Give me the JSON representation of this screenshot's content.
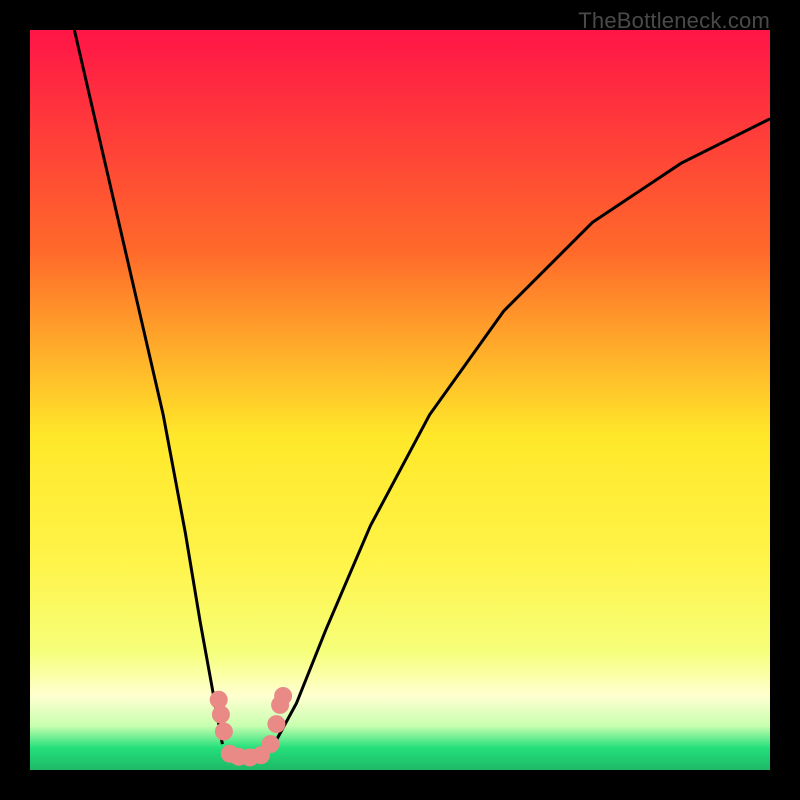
{
  "watermark": "TheBottleneck.com",
  "chart_data": {
    "type": "line",
    "title": "",
    "xlabel": "",
    "ylabel": "",
    "xlim": [
      0,
      1
    ],
    "ylim": [
      0,
      1
    ],
    "gradient_colors": {
      "top": "#ff1547",
      "upper_mid": "#ff8a2a",
      "mid": "#ffe82a",
      "lower_mid": "#f6ff7a",
      "pale": "#ffffd0",
      "bottom_green": "#25e07a",
      "bottom_green_dark": "#1db867"
    },
    "series": [
      {
        "name": "left-branch",
        "x": [
          0.06,
          0.09,
          0.12,
          0.15,
          0.18,
          0.21,
          0.23,
          0.25,
          0.26
        ],
        "y": [
          1.0,
          0.87,
          0.74,
          0.61,
          0.48,
          0.32,
          0.2,
          0.09,
          0.035
        ]
      },
      {
        "name": "right-branch",
        "x": [
          0.33,
          0.36,
          0.4,
          0.46,
          0.54,
          0.64,
          0.76,
          0.88,
          1.0
        ],
        "y": [
          0.035,
          0.09,
          0.19,
          0.33,
          0.48,
          0.62,
          0.74,
          0.82,
          0.88
        ]
      }
    ],
    "markers": {
      "name": "salmon-dots",
      "color": "#e98a86",
      "points": [
        {
          "x": 0.255,
          "y": 0.095
        },
        {
          "x": 0.258,
          "y": 0.075
        },
        {
          "x": 0.262,
          "y": 0.052
        },
        {
          "x": 0.27,
          "y": 0.022
        },
        {
          "x": 0.282,
          "y": 0.018
        },
        {
          "x": 0.297,
          "y": 0.017
        },
        {
          "x": 0.312,
          "y": 0.02
        },
        {
          "x": 0.325,
          "y": 0.035
        },
        {
          "x": 0.333,
          "y": 0.062
        },
        {
          "x": 0.338,
          "y": 0.088
        },
        {
          "x": 0.342,
          "y": 0.1
        }
      ]
    }
  }
}
